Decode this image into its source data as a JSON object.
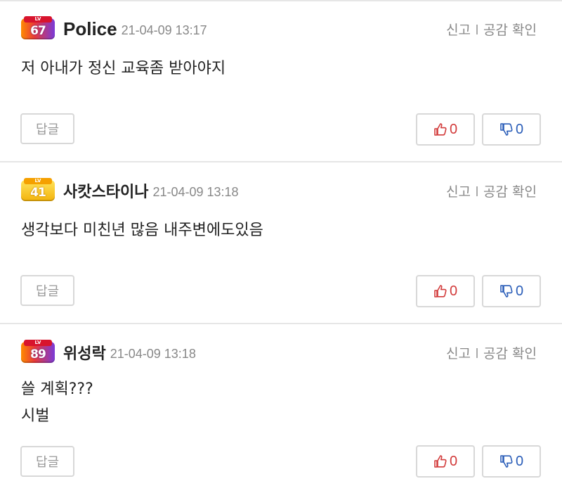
{
  "labels": {
    "report": "신고",
    "likes_check": "공감 확인",
    "reply": "답글"
  },
  "colors": {
    "upvote": "#d23a3a",
    "downvote": "#2a5db8",
    "date": "#888888"
  },
  "comments": [
    {
      "level": "67",
      "badge_lv": "LV",
      "username": "Police",
      "date": "21-04-09 13:17",
      "lines": [
        "저 아내가 정신 교육좀 받아야지"
      ],
      "upvotes": "0",
      "downvotes": "0"
    },
    {
      "level": "41",
      "badge_lv": "LV",
      "username": "사캇스타이나",
      "date": "21-04-09 13:18",
      "lines": [
        "생각보다 미친년 많음 내주변에도있음"
      ],
      "upvotes": "0",
      "downvotes": "0"
    },
    {
      "level": "89",
      "badge_lv": "LV",
      "username": "위성락",
      "date": "21-04-09 13:18",
      "lines": [
        "쓸 계획???",
        "시벌"
      ],
      "upvotes": "0",
      "downvotes": "0"
    }
  ]
}
